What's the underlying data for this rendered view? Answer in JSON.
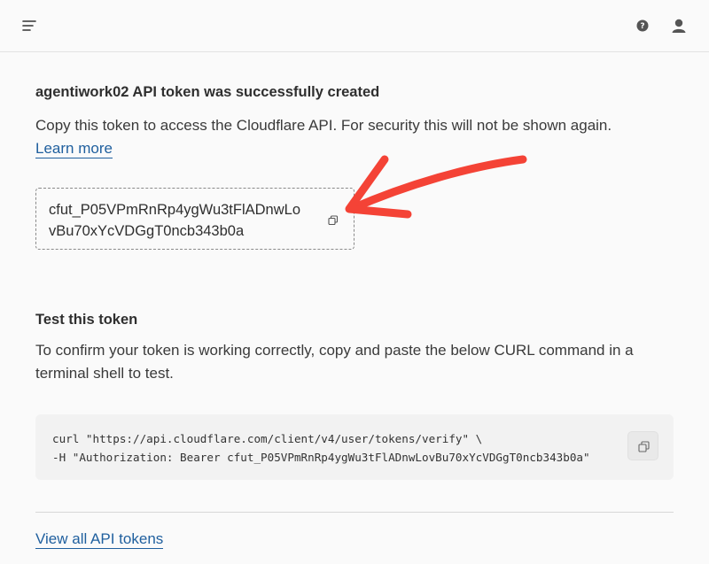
{
  "header": {
    "menu_icon": "hamburger-menu-icon",
    "help_icon": "help-circle-icon",
    "user_icon": "user-account-icon"
  },
  "main": {
    "success_title": "agentiwork02 API token was successfully created",
    "description": "Copy this token to access the Cloudflare API. For security this will not be shown again.",
    "learn_more_label": "Learn more",
    "token_line1": "cfut_P05VPmRnRp4ygWu3tFlADnwLo",
    "token_line2": "vBu70xYcVDGgT0ncb343b0a",
    "copy_icon": "copy-icon",
    "annotation_arrow_color": "#f44336",
    "test_title": "Test this token",
    "test_description": "To confirm your token is working correctly, copy and paste the below CURL command in a terminal shell to test.",
    "curl_line1": "curl \"https://api.cloudflare.com/client/v4/user/tokens/verify\" \\",
    "curl_line2": "-H \"Authorization: Bearer cfut_P05VPmRnRp4ygWu3tFlADnwLovBu70xYcVDGgT0ncb343b0a\"",
    "view_all_label": "View all API tokens"
  },
  "colors": {
    "link": "#1f5f9e",
    "background": "#fafafa",
    "code_background": "#f2f2f2"
  }
}
